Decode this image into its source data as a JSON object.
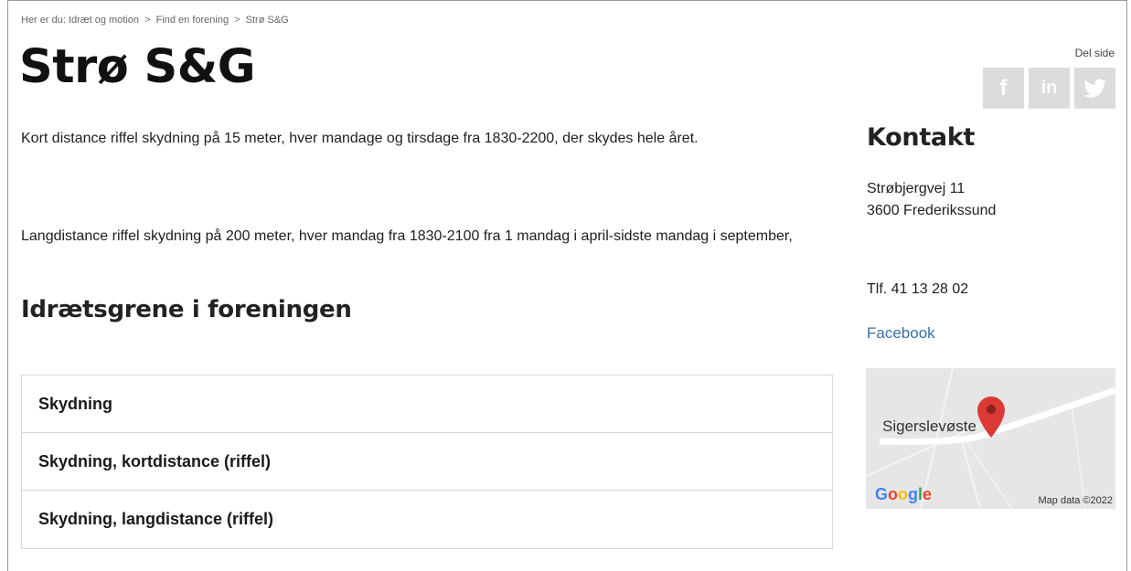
{
  "breadcrumb": {
    "prefix": "Her er du:",
    "items": [
      "Idræt og motion",
      "Find en forening",
      "Strø S&G"
    ],
    "separator": ">"
  },
  "title": "Strø S&G",
  "share": {
    "label": "Del side",
    "icons": [
      "facebook-icon",
      "linkedin-icon",
      "twitter-icon"
    ],
    "glyphs": [
      "f",
      "in",
      "t"
    ]
  },
  "description": {
    "paragraph1": "Kort distance riffel skydning på 15 meter, hver mandage og tirsdage fra 1830-2200, der skydes hele året.",
    "paragraph2": "Langdistance riffel skydning på 200 meter, hver mandag fra 1830-2100 fra 1 mandag i april-sidste mandag i september,"
  },
  "sports": {
    "heading": "Idrætsgrene i foreningen",
    "items": [
      "Skydning",
      "Skydning, kortdistance (riffel)",
      "Skydning, langdistance (riffel)"
    ]
  },
  "contact": {
    "heading": "Kontakt",
    "address_line1": "Strøbjergvej 11",
    "address_line2": "3600 Frederikssund",
    "phone": "Tlf. 41 13 28 02",
    "facebook": "Facebook"
  },
  "map": {
    "place_label": "Sigerslevøste",
    "logo": [
      "G",
      "o",
      "o",
      "g",
      "l",
      "e"
    ],
    "credit": "Map data ©2022",
    "pin_color": "#db3a34"
  },
  "colors": {
    "link": "#3a6ea5",
    "share_bg": "#dcdcdc"
  }
}
